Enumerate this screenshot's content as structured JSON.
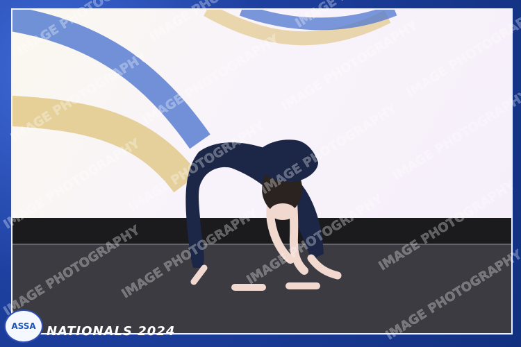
{
  "scene": {
    "description_type": "photo-frame",
    "brand_badge": "ASSA",
    "event_title": "NATIONALS 2024",
    "watermark_text": "IMAGE PHOTOGRAPHY",
    "colors": {
      "frame": "#1d3f9e",
      "frame_light": "#3f6ad8",
      "screen_bg": "#f8f3fa",
      "screen_arc_blue": "#4f77cf",
      "screen_arc_gold": "#d6b14f",
      "stage_black": "#1b1b1e",
      "floor": "#3b3a40",
      "dancer_suit": "#1c2748",
      "hair": "#2a2320"
    }
  }
}
